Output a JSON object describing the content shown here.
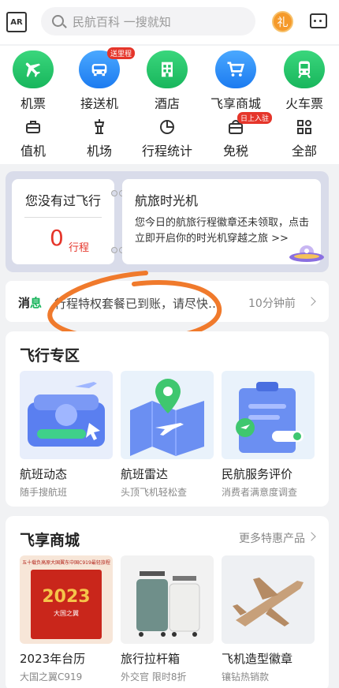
{
  "header": {
    "ar_label": "AR",
    "search_placeholder": "民航百科 一搜就知",
    "gift_label": "礼"
  },
  "nav_row1": [
    {
      "label": "机票",
      "icon": "plane-icon",
      "color": "#1fbf63"
    },
    {
      "label": "接送机",
      "icon": "car-icon",
      "color": "#2a88f5",
      "badge": "送里程"
    },
    {
      "label": "酒店",
      "icon": "hotel-icon",
      "color": "#1fbf63"
    },
    {
      "label": "飞享商城",
      "icon": "cart-icon",
      "color": "#2a88f5"
    },
    {
      "label": "火车票",
      "icon": "train-icon",
      "color": "#1fbf63"
    }
  ],
  "nav_row2": [
    {
      "label": "值机",
      "icon": "checkin-icon"
    },
    {
      "label": "机场",
      "icon": "airport-tower-icon"
    },
    {
      "label": "行程统计",
      "icon": "pie-chart-icon"
    },
    {
      "label": "免税",
      "icon": "dutyfree-bag-icon",
      "badge": "日上入驻"
    },
    {
      "label": "全部",
      "icon": "grid-icon"
    }
  ],
  "timebox": {
    "left_title": "您没有过飞行",
    "count": "0",
    "unit": "行程",
    "right_title": "航旅时光机",
    "right_desc": "您今日的航旅行程徽章还未领取，点击立即开启你的时光机穿越之旅 >>"
  },
  "message": {
    "tag_a": "消",
    "tag_b": "息",
    "text": "行程特权套餐已到账，请尽快…",
    "time": "10分钟前"
  },
  "flight_zone": {
    "title": "飞行专区",
    "cards": [
      {
        "title": "航班动态",
        "sub": "随手搜航班"
      },
      {
        "title": "航班雷达",
        "sub": "头顶飞机轻松查"
      },
      {
        "title": "民航服务评价",
        "sub": "消费者满意度调查"
      }
    ]
  },
  "mall": {
    "title": "飞享商城",
    "more": "更多特惠产品",
    "cards": [
      {
        "title": "2023年台历",
        "sub": "大国之翼C919",
        "img_top": "五十载负高原大国翼东中国C919最轻旅程",
        "img_year": "2023",
        "img_sub": "大国之翼"
      },
      {
        "title": "旅行拉杆箱",
        "sub": "外交官 限时8折"
      },
      {
        "title": "飞机造型徽章",
        "sub": "镶钻热销款"
      }
    ]
  }
}
